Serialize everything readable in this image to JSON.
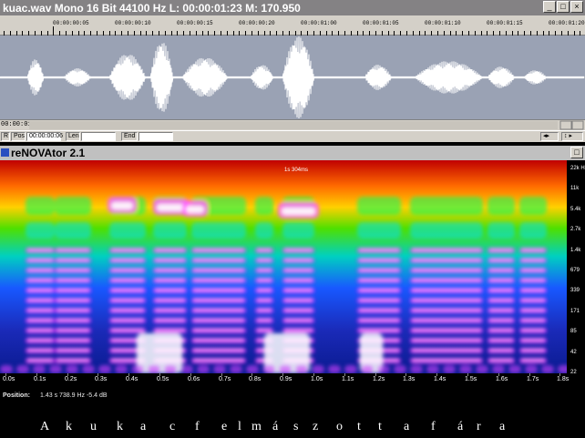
{
  "wave_window": {
    "title": "kuac.wav   Mono 16 Bit 44100 Hz L: 00:00:01:23 M: 170.950",
    "ruler_labels": [
      "00:00:00:05",
      "00:00:00:10",
      "00:00:00:15",
      "00:00:00:20",
      "00:00:01:00",
      "00:00:01:05",
      "00:00:01:10",
      "00:00:01:15",
      "00:00:01:20"
    ],
    "cursor_time": "00:00:01:23",
    "status": {
      "btn_r": "R",
      "pos_label": "Pos",
      "pos_value": "00:00:00:06",
      "len_label": "Len",
      "len_value": "",
      "end_label": "End",
      "end_value": ""
    },
    "window_buttons": [
      "_",
      "□",
      "×"
    ]
  },
  "renovator": {
    "title": "reNOVAtor 2.1",
    "spectrogram_label": "1s 304ms",
    "freq_scale": [
      "22k Hz",
      "11k",
      "5.4k",
      "2.7k",
      "1.4k",
      "679",
      "339",
      "171",
      "85",
      "42",
      "22"
    ],
    "time_labels": [
      "0.0s",
      "0.1s",
      "0.2s",
      "0.3s",
      "0.4s",
      "0.5s",
      "0.6s",
      "0.7s",
      "0.8s",
      "0.9s",
      "1.0s",
      "1.1s",
      "1.2s",
      "1.3s",
      "1.4s",
      "1.5s",
      "1.6s",
      "1.7s",
      "1.8s"
    ],
    "footer": {
      "position_label": "Position:",
      "position_value": "1.43 s   738.9 Hz   -5.4 dB"
    }
  },
  "annotation_letters": [
    "A",
    "k",
    "u",
    "k",
    "a",
    "c",
    "f",
    "e",
    "l",
    "m",
    "á",
    "s",
    "z",
    "o",
    "t",
    "t",
    "a",
    "f",
    "á",
    "r",
    "a"
  ],
  "colors": {
    "title_gray": "#848284",
    "ui_face": "#d4d0c8",
    "wave_bg": "#9aa2b4",
    "spec_low": "#00158a"
  }
}
